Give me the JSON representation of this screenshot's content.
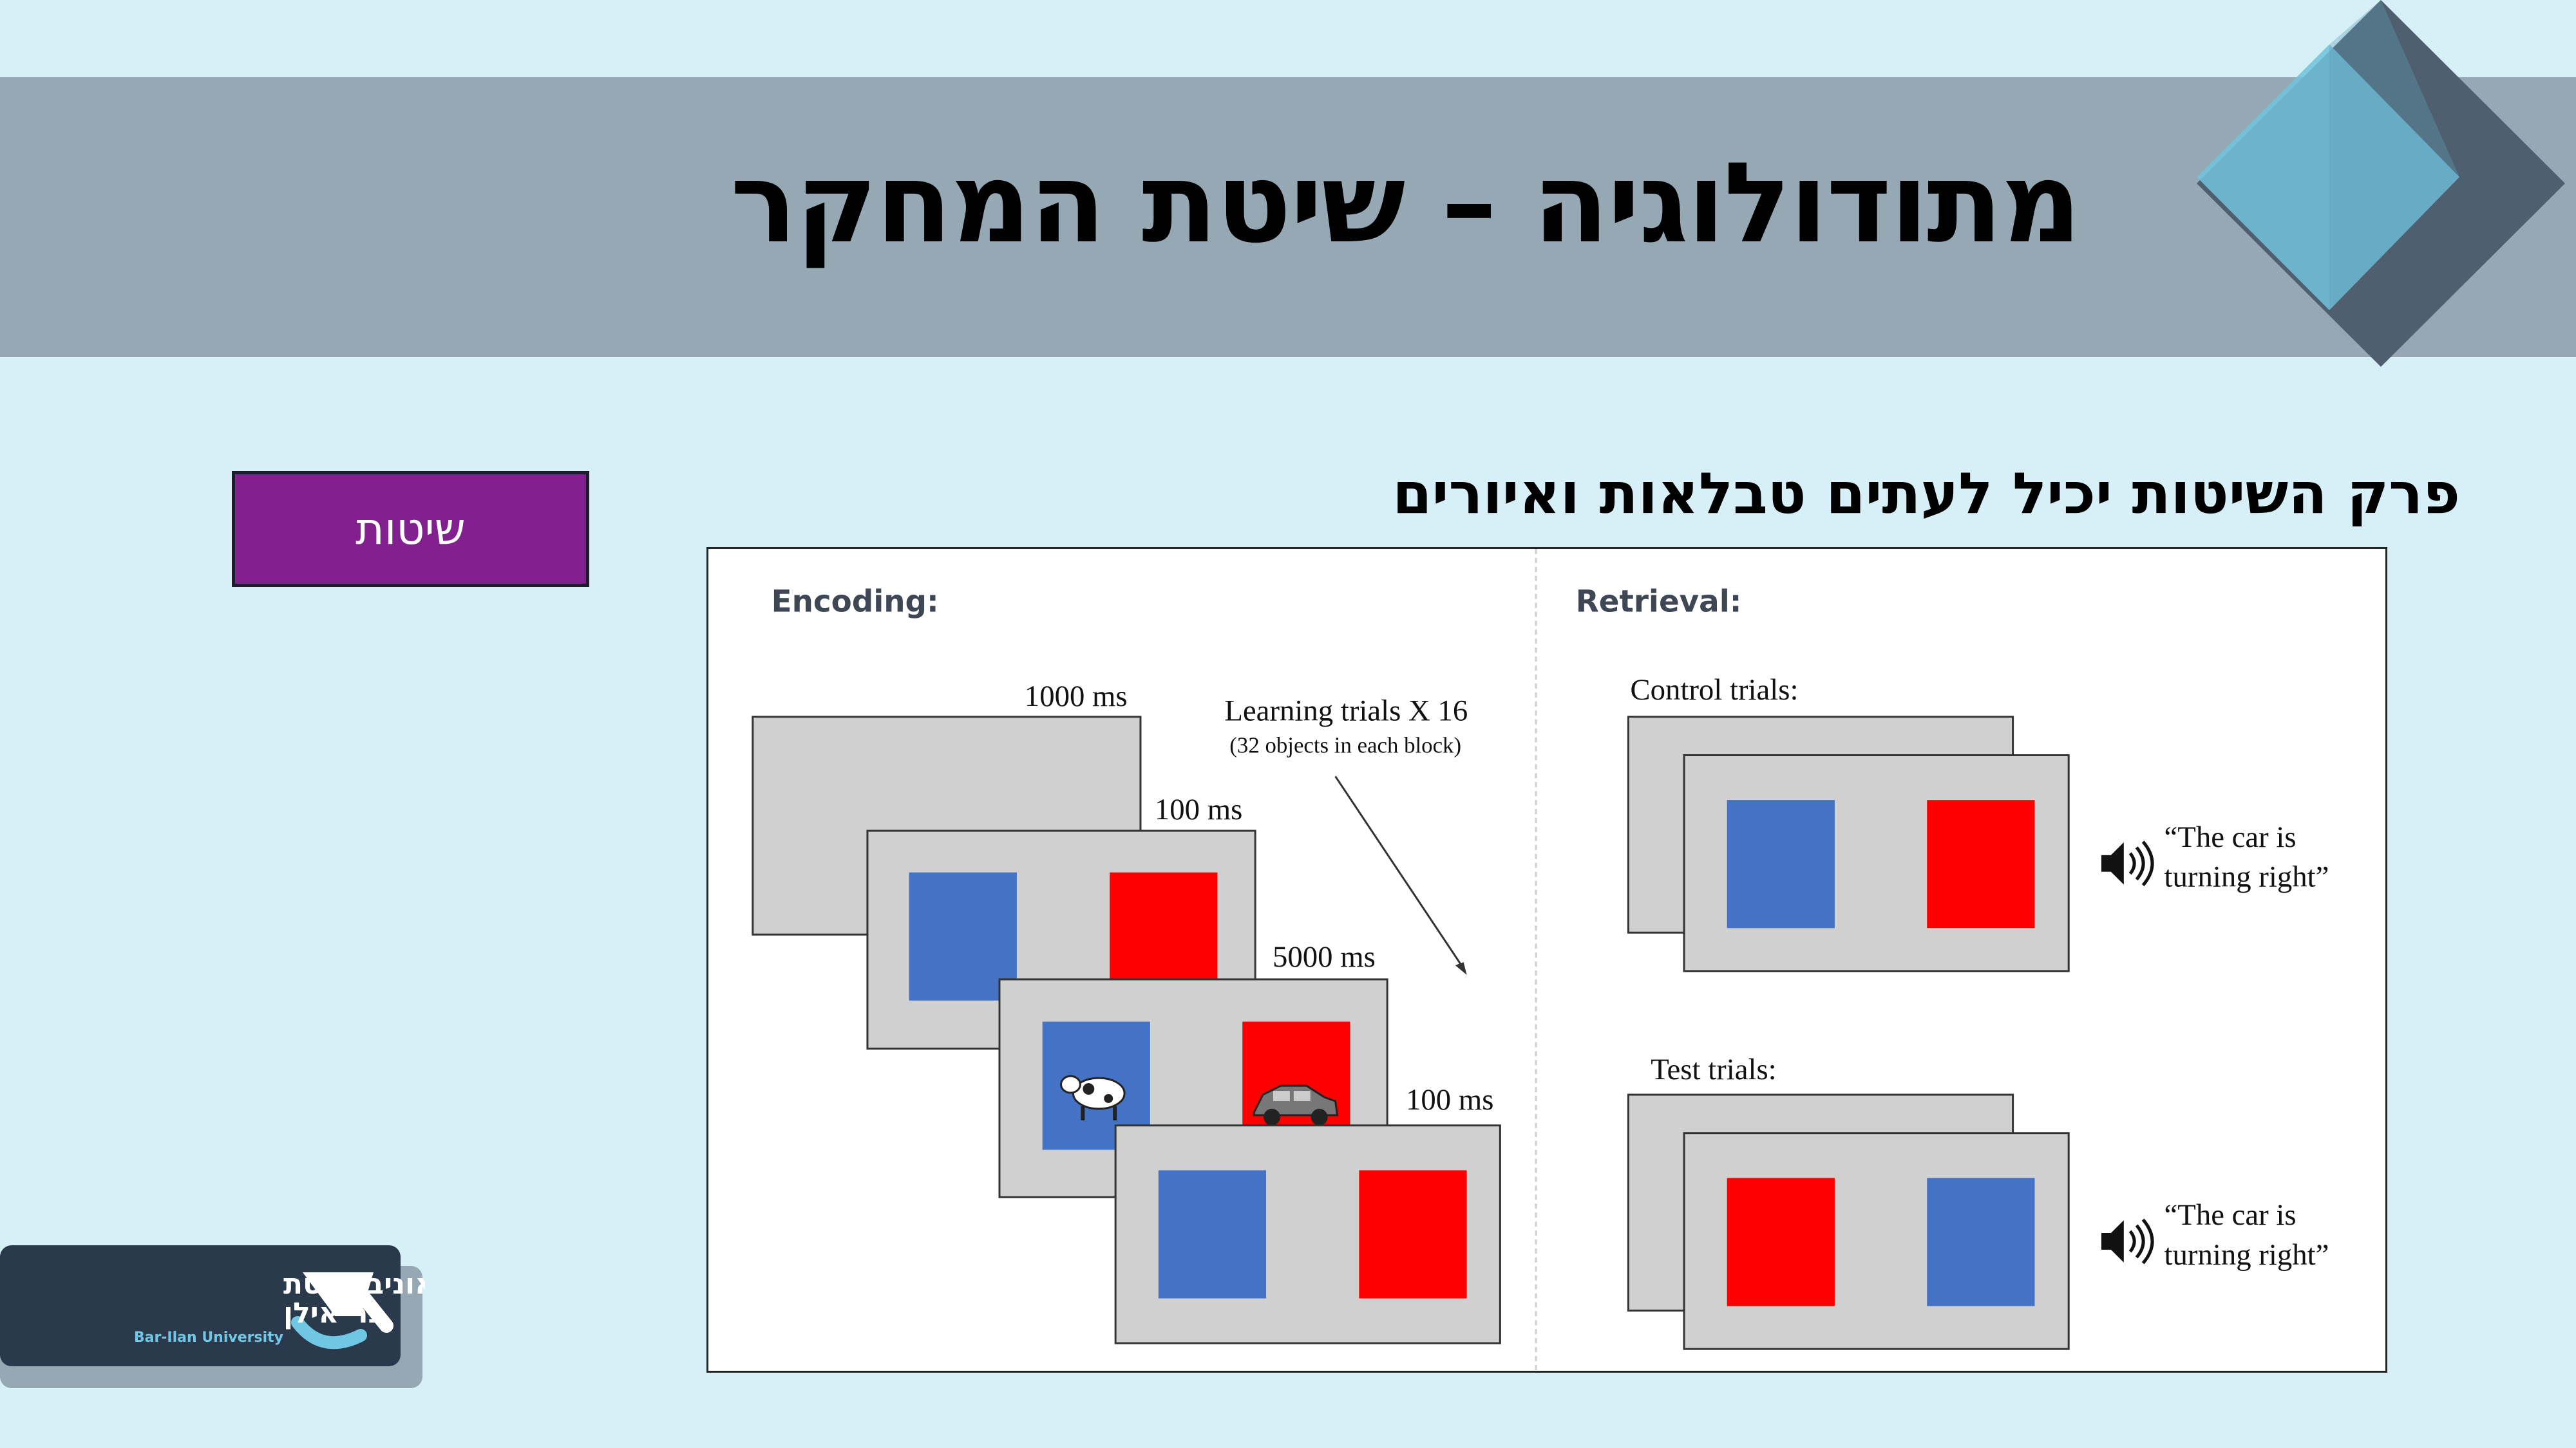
{
  "slide": {
    "title": "מתודולוגיה – שיטת המחקר",
    "subtitle": "פרק השיטות יכיל לעתים טבלאות ואיורים",
    "tag_button": "שיטות"
  },
  "figure": {
    "encoding_label": "Encoding:",
    "retrieval_label": "Retrieval:",
    "t1": "1000 ms",
    "t2": "100 ms",
    "t3": "5000 ms",
    "t4": "100 ms",
    "learning_trials": "Learning trials X 16",
    "learning_note": "(32 objects in each block)",
    "control_trials": "Control trials:",
    "test_trials": "Test trials:",
    "quote_line1": "“The car is",
    "quote_line2": "turning right”",
    "colors": {
      "blue": "#4472c4",
      "red": "#ff0000",
      "gray": "#d0d0d0"
    }
  },
  "logo": {
    "hebrew_line1": "אוניברסיטת",
    "hebrew_line2": "בר־אילן",
    "english": "Bar-Ilan University"
  }
}
